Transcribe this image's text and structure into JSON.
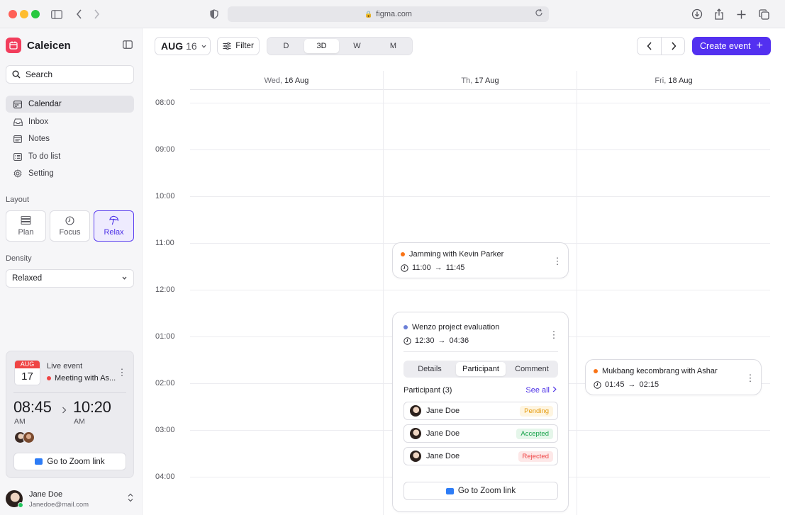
{
  "browser": {
    "url": "figma.com"
  },
  "sidebar": {
    "brand": "Caleicen",
    "search_label": "Search",
    "nav": [
      {
        "label": "Calendar",
        "icon": "calendar-icon",
        "active": true
      },
      {
        "label": "Inbox",
        "icon": "inbox-icon"
      },
      {
        "label": "Notes",
        "icon": "notes-icon"
      },
      {
        "label": "To do list",
        "icon": "todo-icon"
      },
      {
        "label": "Setting",
        "icon": "gear-icon"
      }
    ],
    "layout_label": "Layout",
    "layout_options": [
      {
        "label": "Plan",
        "icon": "plan-icon"
      },
      {
        "label": "Focus",
        "icon": "clock-icon"
      },
      {
        "label": "Relax",
        "icon": "umbrella-icon",
        "active": true
      }
    ],
    "density_label": "Density",
    "density_value": "Relaxed",
    "live_event": {
      "month": "AUG",
      "day": "17",
      "label": "Live event",
      "title": "Meeting with As...",
      "start_time": "08:45",
      "start_ampm": "AM",
      "end_time": "10:20",
      "end_ampm": "AM",
      "zoom_label": "Go to Zoom link"
    },
    "user": {
      "name": "Jane Doe",
      "email": "Janedoe@mail.com"
    }
  },
  "toolbar": {
    "month": "AUG",
    "day": "16",
    "filter_label": "Filter",
    "views": [
      "D",
      "3D",
      "W",
      "M"
    ],
    "active_view": "3D",
    "create_label": "Create event"
  },
  "calendar": {
    "days": [
      {
        "weekday": "Wed,",
        "date": "16 Aug"
      },
      {
        "weekday": "Th,",
        "date": "17 Aug"
      },
      {
        "weekday": "Fri,",
        "date": "18 Aug"
      }
    ],
    "hours": [
      "08:00",
      "09:00",
      "10:00",
      "11:00",
      "12:00",
      "01:00",
      "02:00",
      "03:00",
      "04:00"
    ],
    "events": {
      "jamming": {
        "title": "Jamming with Kevin Parker",
        "start": "11:00",
        "end": "11:45",
        "color": "#f97316"
      },
      "wenzo": {
        "title": "Wenzo project evaluation",
        "start": "12:30",
        "end": "04:36",
        "color": "#6b7fd7",
        "tabs": [
          "Details",
          "Participant",
          "Comment"
        ],
        "active_tab": "Participant",
        "participant_heading": "Participant (3)",
        "see_all": "See all",
        "participants": [
          {
            "name": "Jane Doe",
            "status": "Pending"
          },
          {
            "name": "Jane Doe",
            "status": "Accepted"
          },
          {
            "name": "Jane Doe",
            "status": "Rejected"
          }
        ],
        "zoom_label": "Go to Zoom link"
      },
      "mukbang": {
        "title": "Mukbang kecombrang with Ashar",
        "start": "01:45",
        "end": "02:15",
        "color": "#f97316"
      }
    }
  },
  "colors": {
    "accent": "#5330f0",
    "brand": "#f23d5c",
    "pending": "#f59e0b",
    "accepted": "#16a34a",
    "rejected": "#ef4444"
  }
}
